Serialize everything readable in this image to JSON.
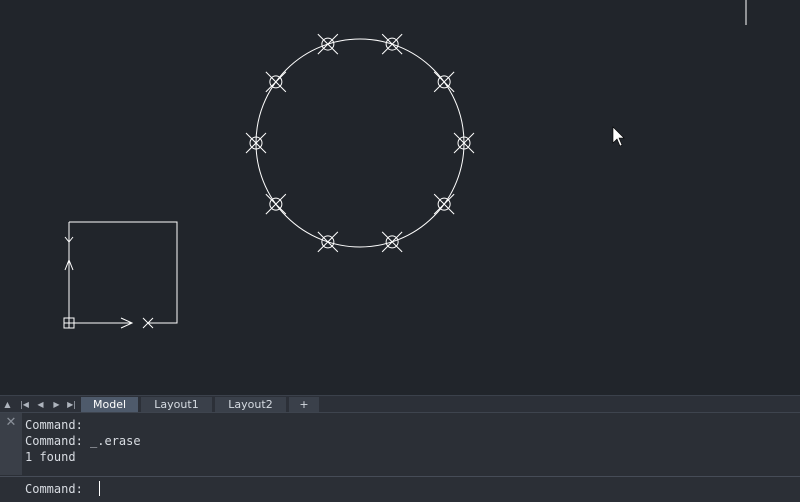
{
  "layout_tabs": [
    {
      "label": "Model",
      "active": true
    },
    {
      "label": "Layout1",
      "active": false
    },
    {
      "label": "Layout2",
      "active": false
    },
    {
      "label": "+",
      "active": false
    }
  ],
  "nav_buttons": [
    "scroll-up-icon",
    "first-tab-icon",
    "prev-tab-icon",
    "next-tab-icon",
    "last-tab-icon"
  ],
  "command": {
    "history": [
      "Command:",
      "Command: _.erase",
      "1 found"
    ],
    "prompt": "Command:",
    "input_value": ""
  },
  "drawing": {
    "objects": [
      "circle",
      "point-markers",
      "ucs-icon",
      "rectangle",
      "crosshair-cursor-line",
      "mouse-pointer"
    ],
    "point_marker_count": 10,
    "stroke_color": "#ffffff",
    "background_color": "#21252b"
  }
}
